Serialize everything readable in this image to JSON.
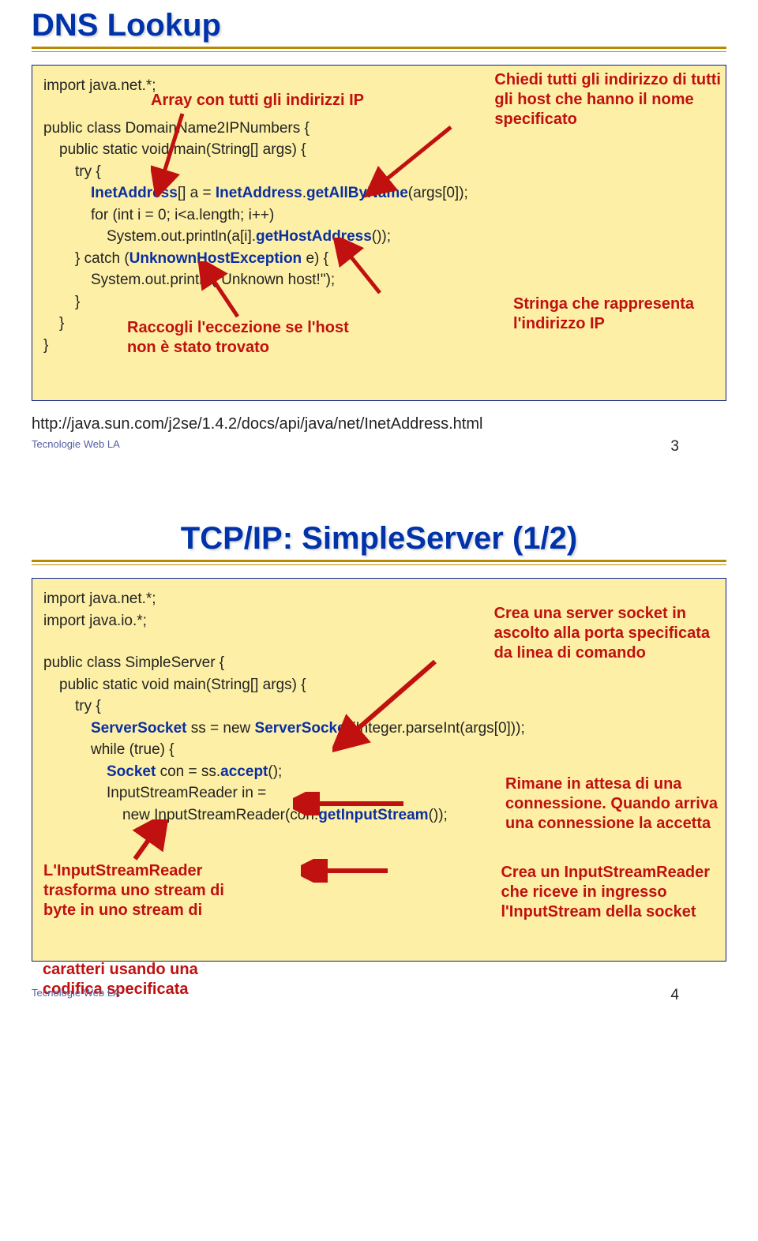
{
  "slide1": {
    "title": "DNS Lookup",
    "code": {
      "l1a": "import java.net.*;",
      "l1_anno": "Array con tutti gli indirizzi IP",
      "l2a": "public class Dom",
      "l2b": "ainName2IPNumbers {",
      "l3": "public static vo",
      "l3b": "id main(String[] args) {",
      "l4": "try {",
      "l5a": "InetAddress",
      "l5b": "[] a = ",
      "l5c": "InetAddress",
      "l5d": ".",
      "l5e": "getAllByName",
      "l5f": "(args[0]);",
      "l6": "for (int i = 0; i<a.length; i++)",
      "l7a": "System.out.println(a[i].",
      "l7b": "getHostAddress",
      "l7c": "());",
      "l8a": "} catch (",
      "l8b": "UnknownHostException",
      "l8c": " e) {",
      "l9": "System.out.println(\"Unknow",
      "l9b": "n host!\");",
      "l10": "}",
      "l11": "}",
      "l12": "}",
      "anno_collect1": "Raccogli l'eccezione se l'host",
      "anno_collect2": "non è stato trovato",
      "anno_top1": "Chiedi tutti gli indirizzo di tutti",
      "anno_top2": "gli host che hanno il nome",
      "anno_top3": "specificato",
      "anno_str1": "Stringa che rappresenta",
      "anno_str2": "l'indirizzo IP"
    },
    "url": "http://java.sun.com/j2se/1.4.2/docs/api/java/net/InetAddress.html",
    "footer": "Tecnologie Web LA",
    "page": "3"
  },
  "slide2": {
    "title": "TCP/IP:  SimpleServer (1/2)",
    "code": {
      "l1": "import java.net.*;",
      "l2": "import java.io.*;",
      "l3": "public class SimpleServer {",
      "l4": "public static void main(String[] args) {",
      "l5": "try {",
      "l6a": "ServerSocket",
      "l6b": " ss = new ",
      "l6c": "ServerSocket",
      "l6d": "(Integer.parseInt(args[0]));",
      "l7": "while (true) {",
      "l8a": "Socket",
      "l8b": " con = ss.",
      "l8c": "accept",
      "l8d": "();",
      "l9a": "InputStre",
      "l9b": "amReader in =",
      "l10a": "new In",
      "l10b": "putStreamReader(con.",
      "l10c": "getInputStream",
      "l10d": "());",
      "anno_srv1": "Crea una server socket in",
      "anno_srv2": "ascolto alla porta specificata",
      "anno_srv3": "da linea di comando",
      "anno_wait1": "Rimane in attesa di una",
      "anno_wait2": "connessione. Quando arriva",
      "anno_wait3": "una connessione la accetta",
      "anno_isr1": "Crea un InputStreamReader",
      "anno_isr2": "che riceve in ingresso",
      "anno_isr3": "l'InputStream della socket",
      "anno_left1": "L'InputStreamReader",
      "anno_left2": "trasforma uno stream di",
      "anno_left3": "byte in uno stream di",
      "anno_left4": "caratteri usando una",
      "anno_left5": "codifica specificata"
    },
    "footer": "Tecnologie Web LA",
    "page": "4"
  }
}
